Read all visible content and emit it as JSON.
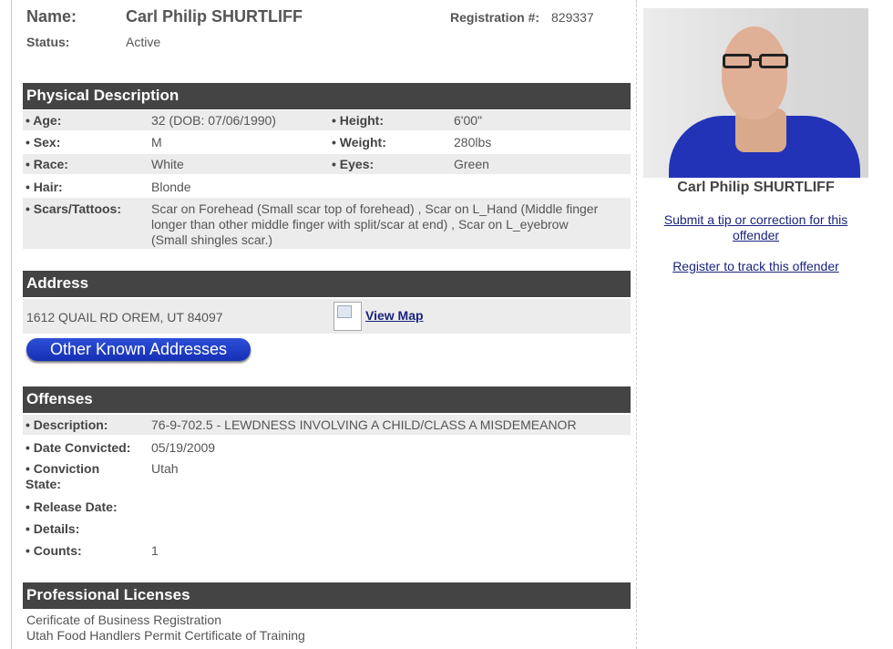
{
  "header": {
    "name_label": "Name:",
    "name": "Carl Philip SHURTLIFF",
    "registration_label": "Registration #:",
    "registration_number": "829337",
    "status_label": "Status:",
    "status": "Active"
  },
  "physical": {
    "title": "Physical Description",
    "age_label": "• Age:",
    "age": "32  (DOB: 07/06/1990)",
    "height_label": "• Height:",
    "height": "6'00\"",
    "sex_label": "• Sex:",
    "sex": "M",
    "weight_label": "• Weight:",
    "weight": "280lbs",
    "race_label": "• Race:",
    "race": "White",
    "eyes_label": "• Eyes:",
    "eyes": "Green",
    "hair_label": "• Hair:",
    "hair": "Blonde",
    "scars_label": "• Scars/Tattoos:",
    "scars_line1": "Scar on Forehead (Small scar top of forehead) , Scar on L_Hand (Middle finger",
    "scars_line2": "longer than other middle finger with split/scar at end) , Scar on L_eyebrow",
    "scars_line3": "(Small shingles scar.)"
  },
  "address": {
    "title": "Address",
    "value": "1612 QUAIL RD OREM, UT 84097",
    "view_map": "View Map",
    "other_addresses_button": "Other Known Addresses"
  },
  "offenses": {
    "title": "Offenses",
    "description_label": "• Description:",
    "description": "76-9-702.5 - LEWDNESS INVOLVING A CHILD/CLASS A MISDEMEANOR",
    "date_convicted_label": "• Date Convicted:",
    "date_convicted": "05/19/2009",
    "conviction_state_label_1": "• Conviction",
    "conviction_state_label_2": "State:",
    "conviction_state": "Utah",
    "release_date_label": "• Release Date:",
    "details_label": "• Details:",
    "counts_label": "• Counts:",
    "counts": "1"
  },
  "licenses": {
    "title": "Professional Licenses",
    "line1": "Cerificate of Business Registration",
    "line2": "Utah Food Handlers Permit Certificate of Training"
  },
  "sidebar": {
    "photo_name": "Carl Philip SHURTLIFF",
    "tip_link_line1": "Submit a tip or correction for this",
    "tip_link_line2": "offender",
    "track_link": "Register to track this offender"
  },
  "colors": {
    "section_bar": "#444444",
    "row_shade": "#ececec",
    "link": "#1a237e",
    "button": "#1530b5"
  }
}
